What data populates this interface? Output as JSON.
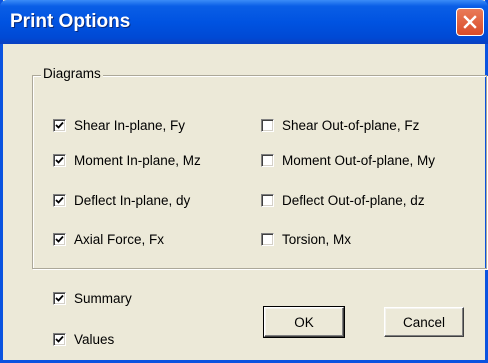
{
  "window": {
    "title": "Print Options"
  },
  "group": {
    "label": "Diagrams"
  },
  "diagrams_left": [
    {
      "label": "Shear In-plane, Fy",
      "checked": true
    },
    {
      "label": "Moment In-plane, Mz",
      "checked": true
    },
    {
      "label": "Deflect In-plane, dy",
      "checked": true
    },
    {
      "label": "Axial Force, Fx",
      "checked": true
    }
  ],
  "diagrams_right": [
    {
      "label": "Shear Out-of-plane, Fz",
      "checked": false
    },
    {
      "label": "Moment Out-of-plane, My",
      "checked": false
    },
    {
      "label": "Deflect Out-of-plane, dz",
      "checked": false
    },
    {
      "label": "Torsion, Mx",
      "checked": false
    }
  ],
  "summary": {
    "label": "Summary",
    "checked": true
  },
  "values": {
    "label": "Values",
    "checked": true
  },
  "buttons": {
    "ok": "OK",
    "cancel": "Cancel"
  },
  "colors": {
    "titlebar": "#0053e1",
    "close": "#d94b2a",
    "face": "#ece9d8"
  }
}
